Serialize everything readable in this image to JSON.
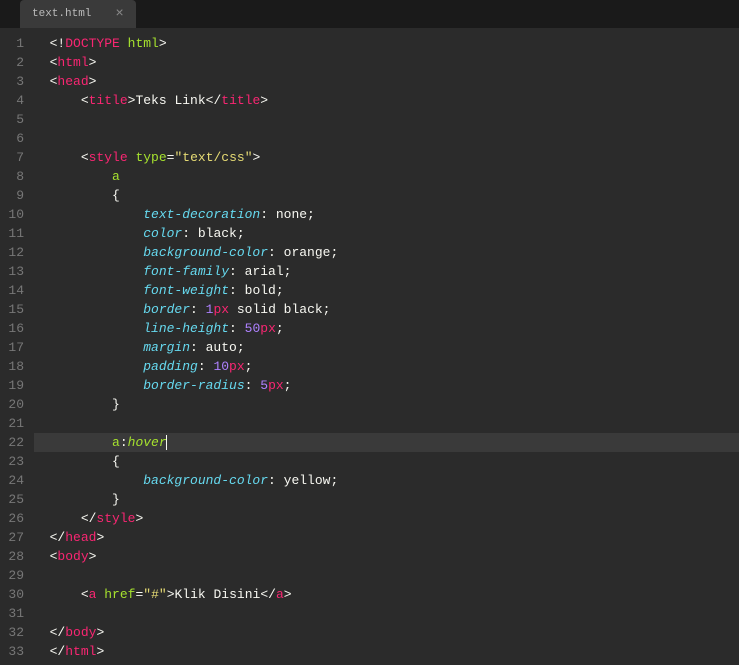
{
  "tab": {
    "filename": "text.html",
    "close_glyph": "×"
  },
  "lines": {
    "l1a": "<!",
    "l1b": "DOCTYPE",
    "l1c": " ",
    "l1d": "html",
    "l1e": ">",
    "l2a": "<",
    "l2b": "html",
    "l2c": ">",
    "l3a": "<",
    "l3b": "head",
    "l3c": ">",
    "l4a": "<",
    "l4b": "title",
    "l4c": ">",
    "l4d": "Teks Link",
    "l4e": "</",
    "l4f": "title",
    "l4g": ">",
    "l7a": "<",
    "l7b": "style",
    "l7c": " ",
    "l7d": "type",
    "l7e": "=",
    "l7f": "\"text/css\"",
    "l7g": ">",
    "l8a": "a",
    "l9a": "{",
    "l10a": "text-decoration",
    "l10b": ": none;",
    "l11a": "color",
    "l11b": ": black;",
    "l12a": "background-color",
    "l12b": ": orange;",
    "l13a": "font-family",
    "l13b": ": arial;",
    "l14a": "font-weight",
    "l14b": ": bold;",
    "l15a": "border",
    "l15b": ": ",
    "l15c": "1",
    "l15d": "px",
    "l15e": " solid black;",
    "l16a": "line-height",
    "l16b": ": ",
    "l16c": "50",
    "l16d": "px",
    "l16e": ";",
    "l17a": "margin",
    "l17b": ": auto;",
    "l18a": "padding",
    "l18b": ": ",
    "l18c": "10",
    "l18d": "px",
    "l18e": ";",
    "l19a": "border-radius",
    "l19b": ": ",
    "l19c": "5",
    "l19d": "px",
    "l19e": ";",
    "l20a": "}",
    "l22a": "a",
    "l22b": ":",
    "l22c": "hover",
    "l23a": "{",
    "l24a": "background-color",
    "l24b": ": yellow;",
    "l25a": "}",
    "l26a": "</",
    "l26b": "style",
    "l26c": ">",
    "l27a": "</",
    "l27b": "head",
    "l27c": ">",
    "l28a": "<",
    "l28b": "body",
    "l28c": ">",
    "l30a": "<",
    "l30b": "a",
    "l30c": " ",
    "l30d": "href",
    "l30e": "=",
    "l30f": "\"#\"",
    "l30g": ">",
    "l30h": "Klik Disini",
    "l30i": "</",
    "l30j": "a",
    "l30k": ">",
    "l32a": "</",
    "l32b": "body",
    "l32c": ">",
    "l33a": "</",
    "l33b": "html",
    "l33c": ">"
  },
  "line_numbers": [
    "1",
    "2",
    "3",
    "4",
    "5",
    "6",
    "7",
    "8",
    "9",
    "10",
    "11",
    "12",
    "13",
    "14",
    "15",
    "16",
    "17",
    "18",
    "19",
    "20",
    "21",
    "22",
    "23",
    "24",
    "25",
    "26",
    "27",
    "28",
    "29",
    "30",
    "31",
    "32",
    "33"
  ]
}
